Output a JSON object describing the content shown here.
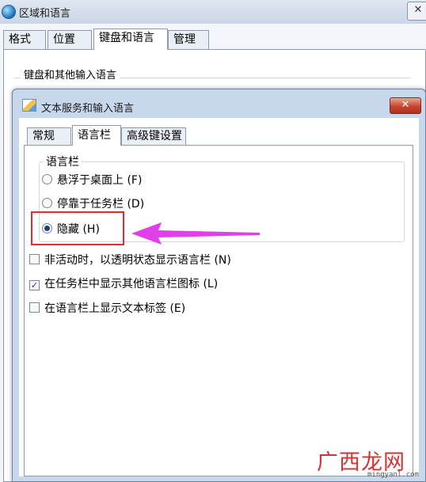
{
  "outer_window": {
    "title": "区域和语言",
    "close_glyph": "✕",
    "tabs": [
      "格式",
      "位置",
      "键盘和语言",
      "管理"
    ],
    "active_tab": "键盘和语言",
    "group_label": "键盘和其他输入语言"
  },
  "dialog": {
    "title": "文本服务和输入语言",
    "close_glyph": "✕",
    "tabs": [
      "常规",
      "语言栏",
      "高级键设置"
    ],
    "active_tab": "语言栏",
    "language_bar_group": "语言栏",
    "radio_options": [
      {
        "label": "悬浮于桌面上 (F)",
        "checked": false
      },
      {
        "label": "停靠于任务栏 (D)",
        "checked": false
      },
      {
        "label": "隐藏 (H)",
        "checked": true
      }
    ],
    "checkboxes": [
      {
        "label": "非活动时，以透明状态显示语言栏 (N)",
        "checked": false
      },
      {
        "label": "在任务栏中显示其他语言栏图标 (L)",
        "checked": true
      },
      {
        "label": "在语言栏上显示文本标签 (E)",
        "checked": false
      }
    ]
  },
  "annotation": {
    "highlight_color": "#e02e2e",
    "arrow_color": "#e040e8"
  },
  "watermark": {
    "main": "广西龙网",
    "sub": "mingyanl.com"
  }
}
